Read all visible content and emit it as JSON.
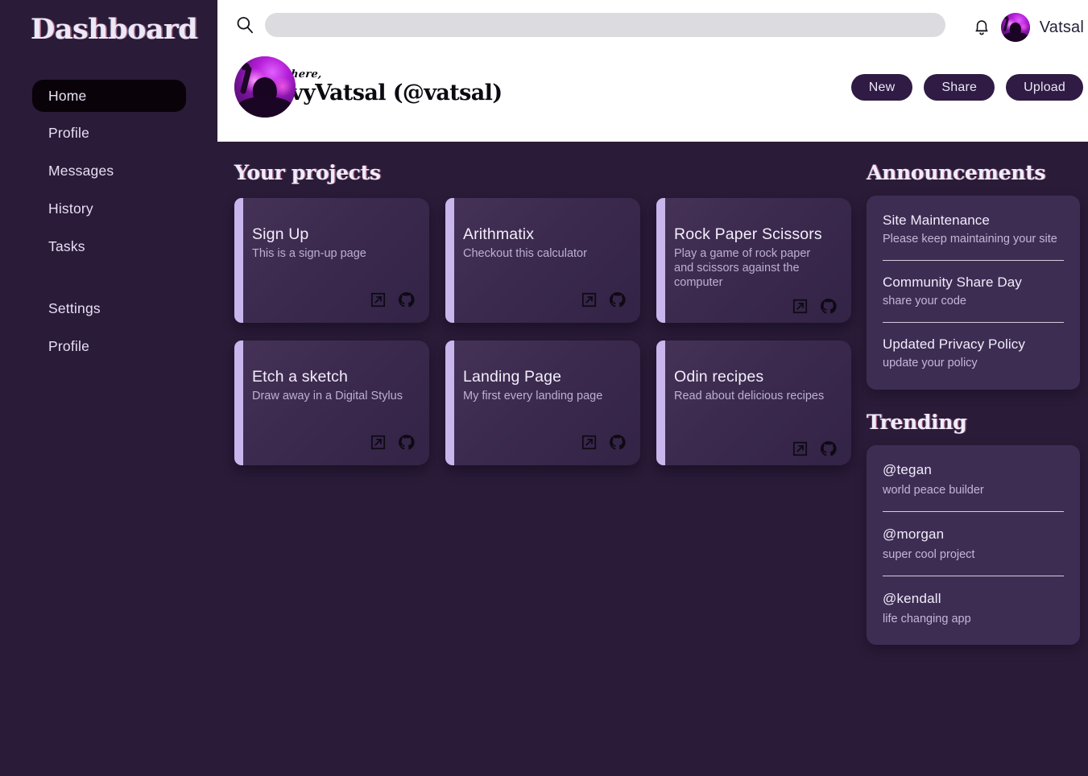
{
  "brand": {
    "title": "Dashboard"
  },
  "sidebar": {
    "items": [
      {
        "label": "Home",
        "active": true
      },
      {
        "label": "Profile",
        "active": false
      },
      {
        "label": "Messages",
        "active": false
      },
      {
        "label": "History",
        "active": false
      },
      {
        "label": "Tasks",
        "active": false
      }
    ],
    "items_secondary": [
      {
        "label": "Settings"
      },
      {
        "label": "Profile"
      }
    ]
  },
  "header": {
    "search": {
      "value": "",
      "placeholder": "",
      "icon": "search-icon"
    },
    "bell_icon": "bell-icon",
    "top_user_name": "Vatsal",
    "greeting": "Hi there,",
    "full_name": "vavyVatsal (@vatsal)",
    "actions": [
      {
        "label": "New"
      },
      {
        "label": "Share"
      },
      {
        "label": "Upload"
      }
    ]
  },
  "projects": {
    "heading": "Your projects",
    "cards": [
      {
        "title": "Sign Up",
        "desc": "This is a sign-up page",
        "link_icon": "external-link-icon",
        "repo_icon": "github-icon"
      },
      {
        "title": "Arithmatix",
        "desc": "Checkout this calculator",
        "link_icon": "external-link-icon",
        "repo_icon": "github-icon"
      },
      {
        "title": "Rock Paper Scissors",
        "desc": "Play a game of rock paper and scissors against the computer",
        "link_icon": "external-link-icon",
        "repo_icon": "github-icon"
      },
      {
        "title": "Etch a sketch",
        "desc": "Draw away in a Digital Stylus",
        "link_icon": "external-link-icon",
        "repo_icon": "github-icon"
      },
      {
        "title": "Landing Page",
        "desc": "My first every landing page",
        "link_icon": "external-link-icon",
        "repo_icon": "github-icon"
      },
      {
        "title": "Odin recipes",
        "desc": "Read about delicious recipes",
        "link_icon": "external-link-icon",
        "repo_icon": "github-icon"
      }
    ]
  },
  "announcements": {
    "heading": "Announcements",
    "items": [
      {
        "title": "Site Maintenance",
        "sub": "Please keep maintaining your site"
      },
      {
        "title": "Community Share Day",
        "sub": "share your code"
      },
      {
        "title": "Updated Privacy Policy",
        "sub": "update your policy"
      }
    ]
  },
  "trending": {
    "heading": "Trending",
    "items": [
      {
        "handle": "@tegan",
        "sub": "world peace builder"
      },
      {
        "handle": "@morgan",
        "sub": "super cool project"
      },
      {
        "handle": "@kendall",
        "sub": "life changing app"
      }
    ]
  },
  "colors": {
    "page_bg": "#2a1b38",
    "header_bg": "#ffffff",
    "card_bg": "#3b2a4e",
    "panel_bg": "#3e2d53",
    "accent_bar": "#c9b6ec",
    "pill_bg": "#2f1b43",
    "active_nav_bg": "#090309",
    "search_bg": "#dcdbe0",
    "text_light": "#f1ebfa",
    "text_muted": "#bdb0d2"
  }
}
